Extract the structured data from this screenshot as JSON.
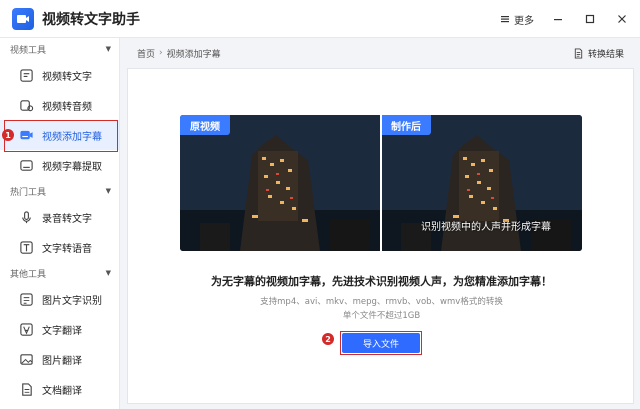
{
  "app": {
    "title": "视频转文字助手"
  },
  "titlebar": {
    "more_label": "更多"
  },
  "sidebar": {
    "groups": [
      {
        "label": "视频工具"
      },
      {
        "label": "热门工具"
      },
      {
        "label": "其他工具"
      }
    ],
    "items": [
      {
        "label": "视频转文字"
      },
      {
        "label": "视频转音频"
      },
      {
        "label": "视频添加字幕"
      },
      {
        "label": "视频字幕提取"
      },
      {
        "label": "录音转文字"
      },
      {
        "label": "文字转语音"
      },
      {
        "label": "图片文字识别"
      },
      {
        "label": "文字翻译"
      },
      {
        "label": "图片翻译"
      },
      {
        "label": "文档翻译"
      }
    ],
    "step1": "1"
  },
  "breadcrumb": {
    "home": "首页",
    "sep": "›",
    "current": "视频添加字幕"
  },
  "header": {
    "convert_result_label": "转换结果"
  },
  "preview": {
    "original_tag": "原视频",
    "after_tag": "制作后",
    "subtitle_text": "识别视频中的人声并形成字幕"
  },
  "main": {
    "headline": "为无字幕的视频加字幕，先进技术识别视频人声，为您精准添加字幕！",
    "formats": "支持mp4、avi、mkv、mepg、rmvb、vob、wmv格式的转换",
    "size_limit": "单个文件不超过1GB",
    "import_label": "导入文件",
    "step2": "2"
  },
  "colors": {
    "accent": "#2f6bff",
    "highlight": "#d32a2a",
    "active_bg": "#e8f0ff"
  }
}
